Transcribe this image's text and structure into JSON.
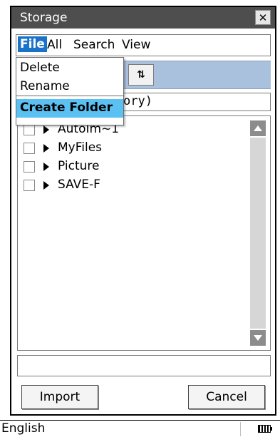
{
  "window": {
    "title": "Storage",
    "close_glyph": "✕"
  },
  "menubar": {
    "items": [
      {
        "label": "File",
        "active": true
      },
      {
        "label": "All"
      },
      {
        "label": "Search"
      },
      {
        "label": "View"
      }
    ]
  },
  "file_menu": {
    "items": [
      {
        "label": "Delete"
      },
      {
        "label": "Rename"
      },
      {
        "label": "Create Folder",
        "selected": true
      }
    ]
  },
  "toolbar": {
    "sort_icon": "sort-icon",
    "sort_glyph": "⇅"
  },
  "path": {
    "visible_text": "ory)"
  },
  "files": [
    {
      "name": "AutoIm~1"
    },
    {
      "name": "MyFiles"
    },
    {
      "name": "Picture"
    },
    {
      "name": "SAVE-F"
    }
  ],
  "name_field": {
    "value": ""
  },
  "buttons": {
    "import": "Import",
    "cancel": "Cancel"
  },
  "statusbar": {
    "language": "English",
    "battery_icon": "battery-icon"
  },
  "colors": {
    "titlebar": "#4e4e4e",
    "toolbar": "#a9c1dc",
    "menu_active": "#1a73c9",
    "menu_selected": "#5bc0f2",
    "scrollbar": "#8c8c8c"
  }
}
